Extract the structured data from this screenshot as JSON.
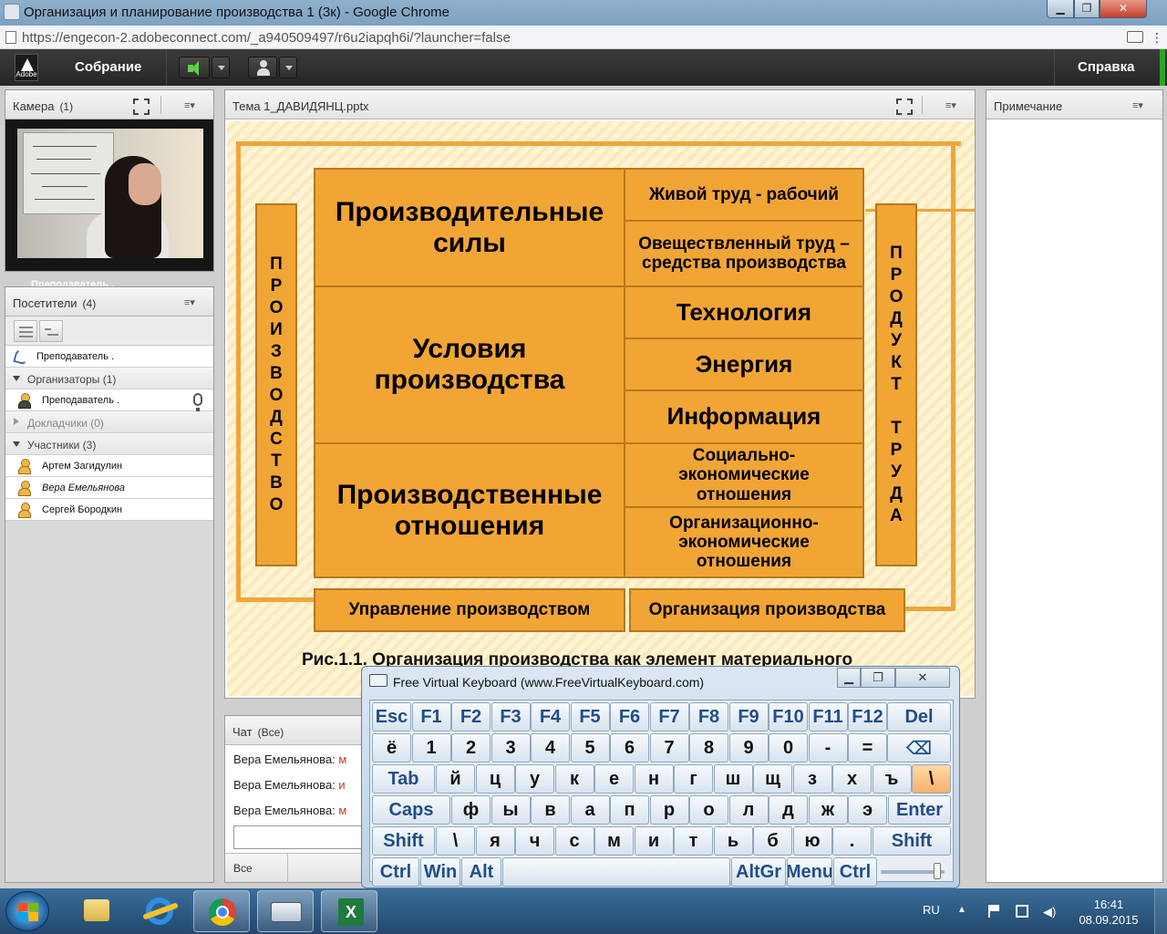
{
  "window": {
    "title": "Организация и планирование производства 1 (3к) - Google Chrome",
    "url": "https://engecon-2.adobeconnect.com/_a940509497/r6u2iapqh6i/?launcher=false",
    "min": "▁",
    "max": "❐",
    "close": "✕"
  },
  "menubar": {
    "logo": "Adobe",
    "meeting": "Собрание",
    "help": "Справка"
  },
  "camera_pod": {
    "title": "Камера",
    "count": "(1)",
    "video_label": "Преподаватель ."
  },
  "attendees_pod": {
    "title": "Посетители",
    "count": "(4)",
    "rows": [
      {
        "kind": "phone",
        "label": "Преподаватель ."
      },
      {
        "kind": "group",
        "label": "Организаторы (1)"
      },
      {
        "kind": "host",
        "label": "Преподаватель ."
      },
      {
        "kind": "group-collapsed",
        "label": "Докладчики (0)"
      },
      {
        "kind": "group",
        "label": "Участники (3)"
      },
      {
        "kind": "user",
        "label": "Артем Загидулин"
      },
      {
        "kind": "user-italic",
        "label": "Вера Емельянова"
      },
      {
        "kind": "user",
        "label": "Сергей Бородкин"
      }
    ]
  },
  "share_pod": {
    "title": "Тема 1_ДАВИДЯНЦ.pptx"
  },
  "slide": {
    "left_vertical": "ПРОИЗВОДСТВО",
    "right_vertical_1": "ПРОДУКТ",
    "right_vertical_2": "ТРУДА",
    "forces": "Производительные силы",
    "conditions": "Условия производства",
    "relations": "Производственные отношения",
    "live_labor": "Живой труд - рабочий",
    "embodied_labor": "Овеществленный труд – средства производства",
    "technology": "Технология",
    "energy": "Энергия",
    "information": "Информация",
    "social_econ": "Социально-экономические отношения",
    "org_econ": "Организационно-экономические отношения",
    "management": "Управление производством",
    "organization": "Организация производства",
    "caption": "Рис.1.1. Организация производства как элемент материального"
  },
  "chat_pod": {
    "title": "Чат",
    "scope": "(Все)",
    "messages": [
      {
        "author": "Вера Емельянова:",
        "text": " м"
      },
      {
        "author": "Вера Емельянова:",
        "text": " и"
      },
      {
        "author": "Вера Емельянова:",
        "text": " м"
      }
    ],
    "footer": "Все"
  },
  "notes_pod": {
    "title": "Примечание"
  },
  "keyboard": {
    "title": "Free Virtual Keyboard (www.FreeVirtualKeyboard.com)",
    "row_fn": [
      "Esc",
      "F1",
      "F2",
      "F3",
      "F4",
      "F5",
      "F6",
      "F7",
      "F8",
      "F9",
      "F10",
      "F11",
      "F12",
      "Del"
    ],
    "row_num": [
      "ё",
      "1",
      "2",
      "3",
      "4",
      "5",
      "6",
      "7",
      "8",
      "9",
      "0",
      "-",
      "=",
      "⌫"
    ],
    "row_top": [
      "Tab",
      "й",
      "ц",
      "у",
      "к",
      "е",
      "н",
      "г",
      "ш",
      "щ",
      "з",
      "х",
      "ъ",
      "\\"
    ],
    "row_home": [
      "Caps",
      "ф",
      "ы",
      "в",
      "а",
      "п",
      "р",
      "о",
      "л",
      "д",
      "ж",
      "э",
      "Enter"
    ],
    "row_shift": [
      "Shift",
      "\\",
      "я",
      "ч",
      "с",
      "м",
      "и",
      "т",
      "ь",
      "б",
      "ю",
      ".",
      "Shift"
    ],
    "row_bottom": [
      "Ctrl",
      "Win",
      "Alt",
      "",
      "AltGr",
      "Menu",
      "Ctrl"
    ]
  },
  "taskbar": {
    "lang": "RU",
    "time": "16:41",
    "date": "08.09.2015",
    "excel_glyph": "X"
  }
}
